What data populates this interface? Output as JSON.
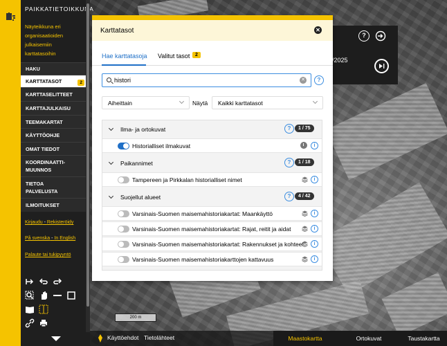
{
  "brand": "PAIKKATIETOIKKUNA",
  "intro": "Näyteikkuna eri organisaatioiden julkaisemiin karttatasoihin",
  "nav": [
    {
      "label": "HAKU"
    },
    {
      "label": "KARTTATASOT",
      "badge": "2",
      "active": true
    },
    {
      "label": "KARTTASELITTEET"
    },
    {
      "label": "KARTTAJULKAISU"
    },
    {
      "label": "TEEMAKARTAT"
    },
    {
      "label": "KÄYTTÖOHJE"
    },
    {
      "label": "OMAT TIEDOT"
    },
    {
      "label": "KOORDINAATTI-\nMUUNNOS"
    },
    {
      "label": "TIETOA\nPALVELUSTA"
    },
    {
      "label": "ILMOITUKSET"
    }
  ],
  "links": {
    "login": "Kirjaudu",
    "register": "Rekisteröidy",
    "swedish": "På svenska",
    "english": "In English",
    "feedback": "Palaute tai tukipyyntö",
    "separator": " - "
  },
  "map": {
    "year_text": "/2025",
    "scale_label": "200 m",
    "terms": "Käyttöehdot",
    "sources": "Tietolähteet",
    "base_maps": [
      "Maastokartta",
      "Ortokuvat",
      "Taustakartta"
    ],
    "active_base": "Maastokartta"
  },
  "dialog": {
    "title": "Karttatasot",
    "tab_search": "Hae karttatasoja",
    "tab_selected": "Valitut tasot",
    "selected_count": "2",
    "search_value": "histori",
    "filter_value": "Aiheittain",
    "show_label": "Näytä",
    "show_value": "Kaikki karttatasot",
    "groups": [
      {
        "name": "Ilma- ja ortokuvat",
        "count": "1 / 75",
        "layers": [
          {
            "name": "Historialliset ilmakuvat",
            "on": true,
            "icon": "clock-icon"
          }
        ]
      },
      {
        "name": "Paikannimet",
        "count": "1 / 18",
        "layers": [
          {
            "name": "Tampereen ja Pirkkalan historialliset nimet",
            "on": false,
            "icon": "layers-icon"
          }
        ]
      },
      {
        "name": "Suojellut alueet",
        "count": "4 / 42",
        "layers": [
          {
            "name": "Varsinais-Suomen maisemahistoriakartat: Maankäyttö",
            "on": false,
            "icon": "layers-icon"
          },
          {
            "name": "Varsinais-Suomen maisemahistoriakartat: Rajat, reitit ja aidat",
            "on": false,
            "icon": "layers-icon"
          },
          {
            "name": "Varsinais-Suomen maisemahistoriakartat: Rakennukset ja kohteet",
            "on": false,
            "icon": "layers-icon"
          },
          {
            "name": "Varsinais-Suomen maisemahistoriakarttojen kattavuus",
            "on": false,
            "icon": "layers-icon"
          }
        ]
      }
    ]
  },
  "colors": {
    "brand_yellow": "#f5c300",
    "accent_blue": "#1e6fc7",
    "sidebar_dark": "#1f1f1f"
  }
}
